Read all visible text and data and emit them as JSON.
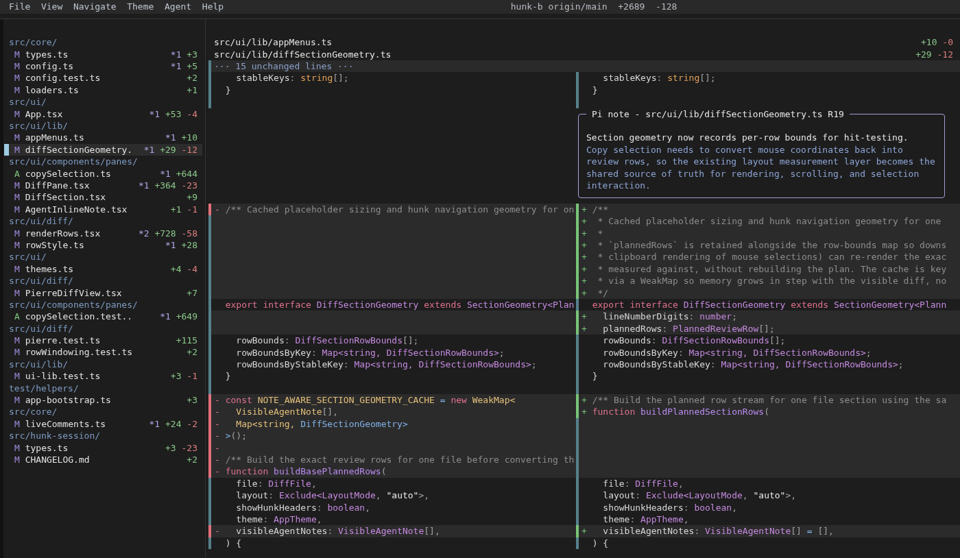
{
  "menu": [
    "File",
    "View",
    "Navigate",
    "Theme",
    "Agent",
    "Help"
  ],
  "title": {
    "branch": "hunk-b origin/main",
    "added": "+2689",
    "removed": "-128"
  },
  "sidebar": {
    "groups": [
      {
        "directory": "src/core/",
        "files": [
          {
            "status": "M",
            "kind": "modified",
            "name": "types.ts",
            "comments": "*1",
            "added": "+3",
            "selected": false
          },
          {
            "status": "M",
            "kind": "modified",
            "name": "config.ts",
            "comments": "*1",
            "added": "+5",
            "selected": false
          },
          {
            "status": "M",
            "kind": "modified",
            "name": "config.test.ts",
            "added": "+2",
            "selected": false
          },
          {
            "status": "M",
            "kind": "modified",
            "name": "loaders.ts",
            "added": "+1",
            "selected": false
          }
        ]
      },
      {
        "directory": "src/ui/",
        "files": [
          {
            "status": "M",
            "kind": "modified",
            "name": "App.tsx",
            "comments": "*1",
            "added": "+53",
            "removed": "-4",
            "selected": false
          }
        ]
      },
      {
        "directory": "src/ui/lib/",
        "files": [
          {
            "status": "M",
            "kind": "modified",
            "name": "appMenus.ts",
            "comments": "*1",
            "added": "+10",
            "selected": false
          },
          {
            "status": "M",
            "kind": "modified",
            "name": "diffSectionGeometry.",
            "comments": "*1",
            "added": "+29",
            "removed": "-12",
            "selected": true
          }
        ]
      },
      {
        "directory": "src/ui/components/panes/",
        "files": [
          {
            "status": "A",
            "kind": "added",
            "name": "copySelection.ts",
            "comments": "*1",
            "added": "+644",
            "selected": false
          },
          {
            "status": "M",
            "kind": "modified",
            "name": "DiffPane.tsx",
            "comments": "*1",
            "added": "+364",
            "removed": "-23",
            "selected": false
          },
          {
            "status": "M",
            "kind": "modified",
            "name": "DiffSection.tsx",
            "added": "+9",
            "selected": false
          },
          {
            "status": "M",
            "kind": "modified",
            "name": "AgentInlineNote.tsx",
            "added": "+1",
            "removed": "-1",
            "selected": false
          }
        ]
      },
      {
        "directory": "src/ui/diff/",
        "files": [
          {
            "status": "M",
            "kind": "modified",
            "name": "renderRows.tsx",
            "comments": "*2",
            "added": "+728",
            "removed": "-58",
            "selected": false
          },
          {
            "status": "M",
            "kind": "modified",
            "name": "rowStyle.ts",
            "comments": "*1",
            "added": "+28",
            "selected": false
          }
        ]
      },
      {
        "directory": "src/ui/",
        "files": [
          {
            "status": "M",
            "kind": "modified",
            "name": "themes.ts",
            "added": "+4",
            "removed": "-4",
            "selected": false
          }
        ]
      },
      {
        "directory": "src/ui/diff/",
        "files": [
          {
            "status": "M",
            "kind": "modified",
            "name": "PierreDiffView.tsx",
            "added": "+7",
            "selected": false
          }
        ]
      },
      {
        "directory": "src/ui/components/panes/",
        "files": [
          {
            "status": "A",
            "kind": "added",
            "name": "copySelection.test..",
            "comments": "*1",
            "added": "+649",
            "selected": false
          }
        ]
      },
      {
        "directory": "src/ui/diff/",
        "files": [
          {
            "status": "M",
            "kind": "modified",
            "name": "pierre.test.ts",
            "added": "+115",
            "selected": false
          },
          {
            "status": "M",
            "kind": "modified",
            "name": "rowWindowing.test.ts",
            "added": "+2",
            "selected": false
          }
        ]
      },
      {
        "directory": "src/ui/lib/",
        "files": [
          {
            "status": "M",
            "kind": "modified",
            "name": "ui-lib.test.ts",
            "added": "+3",
            "removed": "-1",
            "selected": false
          }
        ]
      },
      {
        "directory": "test/helpers/",
        "files": [
          {
            "status": "M",
            "kind": "modified",
            "name": "app-bootstrap.ts",
            "added": "+3",
            "selected": false
          }
        ]
      },
      {
        "directory": "src/core/",
        "files": [
          {
            "status": "M",
            "kind": "modified",
            "name": "liveComments.ts",
            "comments": "*1",
            "added": "+24",
            "removed": "-2",
            "selected": false
          }
        ]
      },
      {
        "directory": "src/hunk-session/",
        "files": [
          {
            "status": "M",
            "kind": "modified",
            "name": "types.ts",
            "added": "+3",
            "removed": "-23",
            "selected": false
          },
          {
            "status": "M",
            "kind": "modified",
            "name": "CHANGELOG.md",
            "added": "+2",
            "selected": false
          }
        ]
      }
    ]
  },
  "diff_view": {
    "files": [
      {
        "path": "src/ui/lib/appMenus.ts",
        "added": "+10",
        "removed": "-0"
      },
      {
        "path": "src/ui/lib/diffSectionGeometry.ts",
        "added": "+29",
        "removed": "-12"
      }
    ],
    "rows": [
      {
        "kind": "collapsed",
        "text": "··· 15 unchanged lines ···"
      },
      {
        "kind": "split",
        "left": {
          "kind": "context",
          "tokens": [
            {
              "text": "  stableKeys",
              "kind": "plain"
            },
            {
              "text": ": ",
              "kind": "punct"
            },
            {
              "text": "string",
              "kind": "builtin"
            },
            {
              "text": "[];",
              "kind": "punct"
            }
          ]
        },
        "right": {
          "kind": "context",
          "tokens": [
            {
              "text": "  stableKeys",
              "kind": "plain"
            },
            {
              "text": ": ",
              "kind": "punct"
            },
            {
              "text": "string",
              "kind": "builtin"
            },
            {
              "text": "[];",
              "kind": "punct"
            }
          ]
        }
      },
      {
        "kind": "split",
        "left": {
          "kind": "context",
          "tokens": [
            {
              "text": "}",
              "kind": "plain"
            }
          ]
        },
        "right": {
          "kind": "context",
          "tokens": [
            {
              "text": "}",
              "kind": "plain"
            }
          ]
        }
      },
      {
        "kind": "split",
        "left": {
          "kind": "context"
        },
        "right": {
          "kind": "context"
        }
      },
      {
        "kind": "note",
        "title": "Pi note - src/ui/lib/diffSectionGeometry.ts R19",
        "summary": "Section geometry now records per-row bounds for hit-testing.",
        "detail": "Copy selection needs to convert mouse coordinates back into review rows, so the existing layout measurement layer becomes the shared source of truth for rendering, scrolling, and selection interaction."
      },
      {
        "kind": "split",
        "left": {
          "kind": "removed",
          "marker": "-",
          "tokens": [
            {
              "text": "/** Cached placeholder sizing and hunk navigation geometry for on",
              "kind": "comment"
            }
          ]
        },
        "right": {
          "kind": "added",
          "marker": "+",
          "tokens": [
            {
              "text": "/**",
              "kind": "comment"
            }
          ]
        }
      },
      {
        "kind": "split",
        "left": {
          "kind": "filler"
        },
        "right": {
          "kind": "added",
          "marker": "+",
          "tokens": [
            {
              "text": " * Cached placeholder sizing and hunk navigation geometry for one",
              "kind": "comment"
            }
          ]
        }
      },
      {
        "kind": "split",
        "left": {
          "kind": "filler"
        },
        "right": {
          "kind": "added",
          "marker": "+",
          "tokens": [
            {
              "text": " *",
              "kind": "comment"
            }
          ]
        }
      },
      {
        "kind": "split",
        "left": {
          "kind": "filler"
        },
        "right": {
          "kind": "added",
          "marker": "+",
          "tokens": [
            {
              "text": " * `plannedRows` is retained alongside the row-bounds map so downs",
              "kind": "comment"
            }
          ]
        }
      },
      {
        "kind": "split",
        "left": {
          "kind": "filler"
        },
        "right": {
          "kind": "added",
          "marker": "+",
          "tokens": [
            {
              "text": " * clipboard rendering of mouse selections) can re-render the exac",
              "kind": "comment"
            }
          ]
        }
      },
      {
        "kind": "split",
        "left": {
          "kind": "filler"
        },
        "right": {
          "kind": "added",
          "marker": "+",
          "tokens": [
            {
              "text": " * measured against, without rebuilding the plan. The cache is key",
              "kind": "comment"
            }
          ]
        }
      },
      {
        "kind": "split",
        "left": {
          "kind": "filler"
        },
        "right": {
          "kind": "added",
          "marker": "+",
          "tokens": [
            {
              "text": " * via a WeakMap so memory grows in step with the visible diff, no",
              "kind": "comment"
            }
          ]
        }
      },
      {
        "kind": "split",
        "left": {
          "kind": "filler"
        },
        "right": {
          "kind": "added",
          "marker": "+",
          "tokens": [
            {
              "text": " */",
              "kind": "comment"
            }
          ]
        }
      },
      {
        "kind": "split",
        "left": {
          "kind": "context",
          "tokens": [
            {
              "text": "export interface ",
              "kind": "keyword"
            },
            {
              "text": "DiffSectionGeometry ",
              "kind": "type"
            },
            {
              "text": "extends ",
              "kind": "keyword"
            },
            {
              "text": "SectionGeometry<Plan",
              "kind": "type"
            }
          ]
        },
        "right": {
          "kind": "context",
          "tokens": [
            {
              "text": "export interface ",
              "kind": "keyword"
            },
            {
              "text": "DiffSectionGeometry ",
              "kind": "type"
            },
            {
              "text": "extends ",
              "kind": "keyword"
            },
            {
              "text": "SectionGeometry<Plann",
              "kind": "type"
            }
          ]
        }
      },
      {
        "kind": "split",
        "left": {
          "kind": "filler"
        },
        "right": {
          "kind": "added",
          "marker": "+",
          "tokens": [
            {
              "text": "  lineNumberDigits",
              "kind": "plain"
            },
            {
              "text": ": ",
              "kind": "punct"
            },
            {
              "text": "number",
              "kind": "type"
            },
            {
              "text": ";",
              "kind": "punct"
            }
          ]
        }
      },
      {
        "kind": "split",
        "left": {
          "kind": "filler"
        },
        "right": {
          "kind": "added",
          "marker": "+",
          "tokens": [
            {
              "text": "  plannedRows",
              "kind": "plain"
            },
            {
              "text": ": ",
              "kind": "punct"
            },
            {
              "text": "PlannedReviewRow",
              "kind": "type"
            },
            {
              "text": "[];",
              "kind": "punct"
            }
          ]
        }
      },
      {
        "kind": "split",
        "left": {
          "kind": "context",
          "tokens": [
            {
              "text": "  rowBounds",
              "kind": "plain"
            },
            {
              "text": ": ",
              "kind": "punct"
            },
            {
              "text": "DiffSectionRowBounds",
              "kind": "type"
            },
            {
              "text": "[];",
              "kind": "punct"
            }
          ]
        },
        "right": {
          "kind": "context",
          "tokens": [
            {
              "text": "  rowBounds",
              "kind": "plain"
            },
            {
              "text": ": ",
              "kind": "punct"
            },
            {
              "text": "DiffSectionRowBounds",
              "kind": "type"
            },
            {
              "text": "[];",
              "kind": "punct"
            }
          ]
        }
      },
      {
        "kind": "split",
        "left": {
          "kind": "context",
          "tokens": [
            {
              "text": "  rowBoundsByKey",
              "kind": "plain"
            },
            {
              "text": ": ",
              "kind": "punct"
            },
            {
              "text": "Map<string, DiffSectionRowBounds>",
              "kind": "type"
            },
            {
              "text": ";",
              "kind": "punct"
            }
          ]
        },
        "right": {
          "kind": "context",
          "tokens": [
            {
              "text": "  rowBoundsByKey",
              "kind": "plain"
            },
            {
              "text": ": ",
              "kind": "punct"
            },
            {
              "text": "Map<string, DiffSectionRowBounds>",
              "kind": "type"
            },
            {
              "text": ";",
              "kind": "punct"
            }
          ]
        }
      },
      {
        "kind": "split",
        "left": {
          "kind": "context",
          "tokens": [
            {
              "text": "  rowBoundsByStableKey",
              "kind": "plain"
            },
            {
              "text": ": ",
              "kind": "punct"
            },
            {
              "text": "Map<string, DiffSectionRowBounds>",
              "kind": "type"
            },
            {
              "text": ";",
              "kind": "punct"
            }
          ]
        },
        "right": {
          "kind": "context",
          "tokens": [
            {
              "text": "  rowBoundsByStableKey",
              "kind": "plain"
            },
            {
              "text": ": ",
              "kind": "punct"
            },
            {
              "text": "Map<string, DiffSectionRowBounds>",
              "kind": "type"
            },
            {
              "text": ";",
              "kind": "punct"
            }
          ]
        }
      },
      {
        "kind": "split",
        "left": {
          "kind": "context",
          "tokens": [
            {
              "text": "}",
              "kind": "plain"
            }
          ]
        },
        "right": {
          "kind": "context",
          "tokens": [
            {
              "text": "}",
              "kind": "plain"
            }
          ]
        }
      },
      {
        "kind": "split",
        "left": {
          "kind": "context"
        },
        "right": {
          "kind": "context"
        }
      },
      {
        "kind": "split",
        "left": {
          "kind": "removed",
          "marker": "-",
          "tokens": [
            {
              "text": "const ",
              "kind": "keyword"
            },
            {
              "text": "NOTE_AWARE_SECTION_GEOMETRY_CACHE",
              "kind": "constant"
            },
            {
              "text": " = ",
              "kind": "alt"
            },
            {
              "text": "new ",
              "kind": "keyword"
            },
            {
              "text": "WeakMap<",
              "kind": "constant"
            }
          ]
        },
        "right": {
          "kind": "added",
          "marker": "+",
          "tokens": [
            {
              "text": "/** Build the planned row stream for one file section using the sa",
              "kind": "comment"
            }
          ]
        }
      },
      {
        "kind": "split",
        "left": {
          "kind": "removed",
          "marker": "-",
          "tokens": [
            {
              "text": "  VisibleAgentNote",
              "kind": "constant"
            },
            {
              "text": "[],",
              "kind": "punct"
            }
          ]
        },
        "right": {
          "kind": "added",
          "marker": "+",
          "tokens": [
            {
              "text": "function ",
              "kind": "keyword"
            },
            {
              "text": "buildPlannedSectionRows",
              "kind": "function"
            },
            {
              "text": "(",
              "kind": "punct"
            }
          ]
        }
      },
      {
        "kind": "split",
        "left": {
          "kind": "removed",
          "marker": "-",
          "tokens": [
            {
              "text": "  Map<string, ",
              "kind": "constant"
            },
            {
              "text": "DiffSectionGeometry>",
              "kind": "alt"
            }
          ]
        },
        "right": {
          "kind": "filler"
        }
      },
      {
        "kind": "split",
        "left": {
          "kind": "removed",
          "marker": "-",
          "tokens": [
            {
              "text": ">",
              "kind": "alt"
            },
            {
              "text": "();",
              "kind": "punct"
            }
          ]
        },
        "right": {
          "kind": "filler"
        }
      },
      {
        "kind": "split",
        "left": {
          "kind": "removed",
          "marker": "-"
        },
        "right": {
          "kind": "filler"
        }
      },
      {
        "kind": "split",
        "left": {
          "kind": "removed",
          "marker": "-",
          "tokens": [
            {
              "text": "/** Build the exact review rows for one file before converting th",
              "kind": "comment"
            }
          ]
        },
        "right": {
          "kind": "filler"
        }
      },
      {
        "kind": "split",
        "left": {
          "kind": "removed",
          "marker": "-",
          "tokens": [
            {
              "text": "function ",
              "kind": "keyword"
            },
            {
              "text": "buildBasePlannedRows",
              "kind": "function"
            },
            {
              "text": "(",
              "kind": "punct"
            }
          ]
        },
        "right": {
          "kind": "filler"
        }
      },
      {
        "kind": "split",
        "left": {
          "kind": "context",
          "tokens": [
            {
              "text": "  file",
              "kind": "plain"
            },
            {
              "text": ": ",
              "kind": "punct"
            },
            {
              "text": "DiffFile",
              "kind": "type"
            },
            {
              "text": ",",
              "kind": "punct"
            }
          ]
        },
        "right": {
          "kind": "context",
          "tokens": [
            {
              "text": "  file",
              "kind": "plain"
            },
            {
              "text": ": ",
              "kind": "punct"
            },
            {
              "text": "DiffFile",
              "kind": "type"
            },
            {
              "text": ",",
              "kind": "punct"
            }
          ]
        }
      },
      {
        "kind": "split",
        "left": {
          "kind": "context",
          "tokens": [
            {
              "text": "  layout",
              "kind": "plain"
            },
            {
              "text": ": ",
              "kind": "punct"
            },
            {
              "text": "Exclude<LayoutMode",
              "kind": "type"
            },
            {
              "text": ", ",
              "kind": "punct"
            },
            {
              "text": "\"auto\"",
              "kind": "string"
            },
            {
              "text": ">,",
              "kind": "punct"
            }
          ]
        },
        "right": {
          "kind": "context",
          "tokens": [
            {
              "text": "  layout",
              "kind": "plain"
            },
            {
              "text": ": ",
              "kind": "punct"
            },
            {
              "text": "Exclude<LayoutMode",
              "kind": "type"
            },
            {
              "text": ", ",
              "kind": "punct"
            },
            {
              "text": "\"auto\"",
              "kind": "string"
            },
            {
              "text": ">,",
              "kind": "punct"
            }
          ]
        }
      },
      {
        "kind": "split",
        "left": {
          "kind": "context",
          "tokens": [
            {
              "text": "  showHunkHeaders",
              "kind": "plain"
            },
            {
              "text": ": ",
              "kind": "punct"
            },
            {
              "text": "boolean",
              "kind": "type"
            },
            {
              "text": ",",
              "kind": "punct"
            }
          ]
        },
        "right": {
          "kind": "context",
          "tokens": [
            {
              "text": "  showHunkHeaders",
              "kind": "plain"
            },
            {
              "text": ": ",
              "kind": "punct"
            },
            {
              "text": "boolean",
              "kind": "type"
            },
            {
              "text": ",",
              "kind": "punct"
            }
          ]
        }
      },
      {
        "kind": "split",
        "left": {
          "kind": "context",
          "tokens": [
            {
              "text": "  theme",
              "kind": "plain"
            },
            {
              "text": ": ",
              "kind": "punct"
            },
            {
              "text": "AppTheme",
              "kind": "type"
            },
            {
              "text": ",",
              "kind": "punct"
            }
          ]
        },
        "right": {
          "kind": "context",
          "tokens": [
            {
              "text": "  theme",
              "kind": "plain"
            },
            {
              "text": ": ",
              "kind": "punct"
            },
            {
              "text": "AppTheme",
              "kind": "type"
            },
            {
              "text": ",",
              "kind": "punct"
            }
          ]
        }
      },
      {
        "kind": "split",
        "left": {
          "kind": "removed",
          "marker": "-",
          "tokens": [
            {
              "text": "  visibleAgentNotes",
              "kind": "plain"
            },
            {
              "text": ": ",
              "kind": "punct"
            },
            {
              "text": "VisibleAgentNote",
              "kind": "type"
            },
            {
              "text": "[],",
              "kind": "punct"
            }
          ]
        },
        "right": {
          "kind": "added",
          "marker": "+",
          "tokens": [
            {
              "text": "  visibleAgentNotes",
              "kind": "plain"
            },
            {
              "text": ": ",
              "kind": "punct"
            },
            {
              "text": "VisibleAgentNote",
              "kind": "type"
            },
            {
              "text": "[] ",
              "kind": "punct"
            },
            {
              "text": "=",
              "kind": "alt"
            },
            {
              "text": " [],",
              "kind": "punct"
            }
          ]
        }
      },
      {
        "kind": "split",
        "left": {
          "kind": "context",
          "tokens": [
            {
              "text": ") {",
              "kind": "plain"
            }
          ]
        },
        "right": {
          "kind": "context",
          "tokens": [
            {
              "text": ") {",
              "kind": "plain"
            }
          ]
        }
      }
    ]
  }
}
